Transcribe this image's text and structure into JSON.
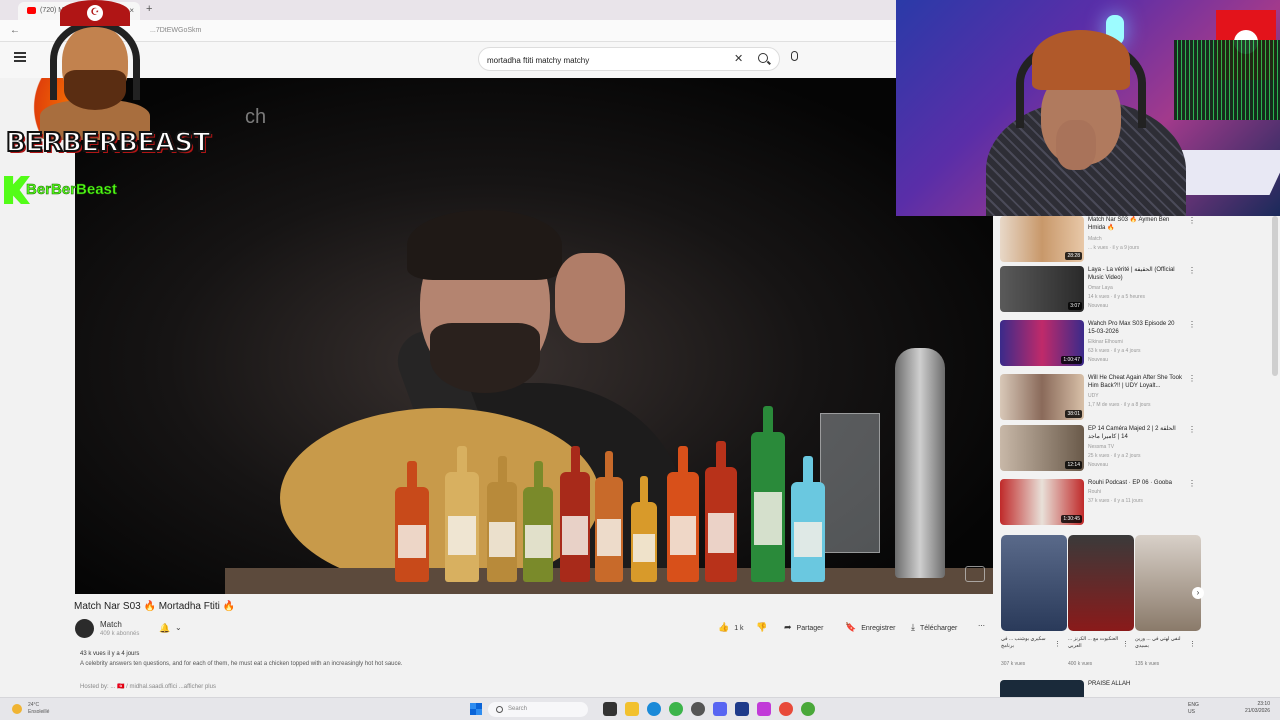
{
  "browser": {
    "tab_title": "(720) Mo...",
    "url": "...7DtEWGoSkm",
    "new_tab": "+"
  },
  "search": {
    "query": "mortadha ftiti matchy matchy"
  },
  "player": {
    "watermark": "ch"
  },
  "video": {
    "title": "Match Nar S03 🔥 Mortadha Ftiti 🔥",
    "channel": "Match",
    "subscribers": "409 k abonnés",
    "likes": "1 k",
    "share_label": "Partager",
    "save_label": "Enregistrer",
    "download_label": "Télécharger",
    "more": "⋯",
    "meta": "43 k vues  il y a 4 jours",
    "description": "A celebrity answers ten questions, and for each of them, he must eat a chicken topped with an increasingly hot hot sauce.",
    "hosted_by": "Hosted by:  ... 🇹🇳 / midhal.saadi.offici  ...afficher plus"
  },
  "recommendations": [
    {
      "title": "Match Nar S03 🔥 Aymen Ben Hmida 🔥",
      "channel": "Match",
      "views": "... k vues · il y a 9 jours",
      "badge": "",
      "duration": "28:28"
    },
    {
      "title": "Laya - La vérité | الحقيقة (Official Music Video)",
      "channel": "Omar Laya",
      "views": "14 k vues · il y a 5 heures",
      "badge": "Nouveau",
      "duration": "3:07"
    },
    {
      "title": "Wahch Pro Max S03 Episode 20 15-03-2026",
      "channel": "Elkinar Elhoumi",
      "views": "63 k vues · il y a 4 jours",
      "badge": "Nouveau",
      "duration": "1:00:47"
    },
    {
      "title": "Will He Cheat Again After She Took Him Back?!! | UDY Loyalt...",
      "channel": "UDY",
      "views": "1,7 M de vues · il y a 8 jours",
      "badge": "",
      "duration": "38:01"
    },
    {
      "title": "EP 14 Caméra Majed 2 | 2 الحلقة 14 | كاميرا ماجد",
      "channel": "Nessma TV",
      "views": "25 k vues · il y a 2 jours",
      "badge": "Nouveau",
      "duration": "12:14"
    },
    {
      "title": "Rouhi Podcast · EP 06 · Gooba",
      "channel": "Rouhi",
      "views": "37 k vues · il y a 11 jours",
      "badge": "",
      "duration": "1:30:45"
    }
  ],
  "shorts": [
    {
      "title": "سكيري بوشنب ... في برنامج",
      "views": "307 k vues"
    },
    {
      "title": "... العنكبوت مع ... الكرنز العربي",
      "views": "400 k vues"
    },
    {
      "title": "لنفي لهتي في ... ورين بسيدي",
      "views": "135 k vues"
    }
  ],
  "last_recommendation": {
    "title": "PRAISE ALLAH"
  },
  "taskbar": {
    "weather_temp": "24°C",
    "weather_text": "Ensoleillé",
    "search_placeholder": "Search",
    "lang_top": "ENG",
    "lang_bottom": "US",
    "time": "23:10",
    "date": "21/03/2026"
  },
  "overlay": {
    "logo_text": "BERBERBEAST",
    "logo_badge": "☪",
    "kick_handle": "BerBerBeast"
  },
  "colors": {
    "youtube_red": "#ff0000",
    "kick_green": "#53fc18",
    "logo_red": "#b01515"
  }
}
